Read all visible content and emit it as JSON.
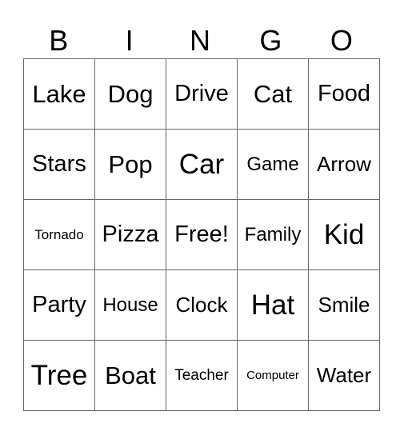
{
  "header": [
    "B",
    "I",
    "N",
    "G",
    "O"
  ],
  "rows": [
    [
      "Lake",
      "Dog",
      "Drive",
      "Cat",
      "Food"
    ],
    [
      "Stars",
      "Pop",
      "Car",
      "Game",
      "Arrow"
    ],
    [
      "Tornado",
      "Pizza",
      "Free!",
      "Family",
      "Kid"
    ],
    [
      "Party",
      "House",
      "Clock",
      "Hat",
      "Smile"
    ],
    [
      "Tree",
      "Boat",
      "Teacher",
      "Computer",
      "Water"
    ]
  ]
}
